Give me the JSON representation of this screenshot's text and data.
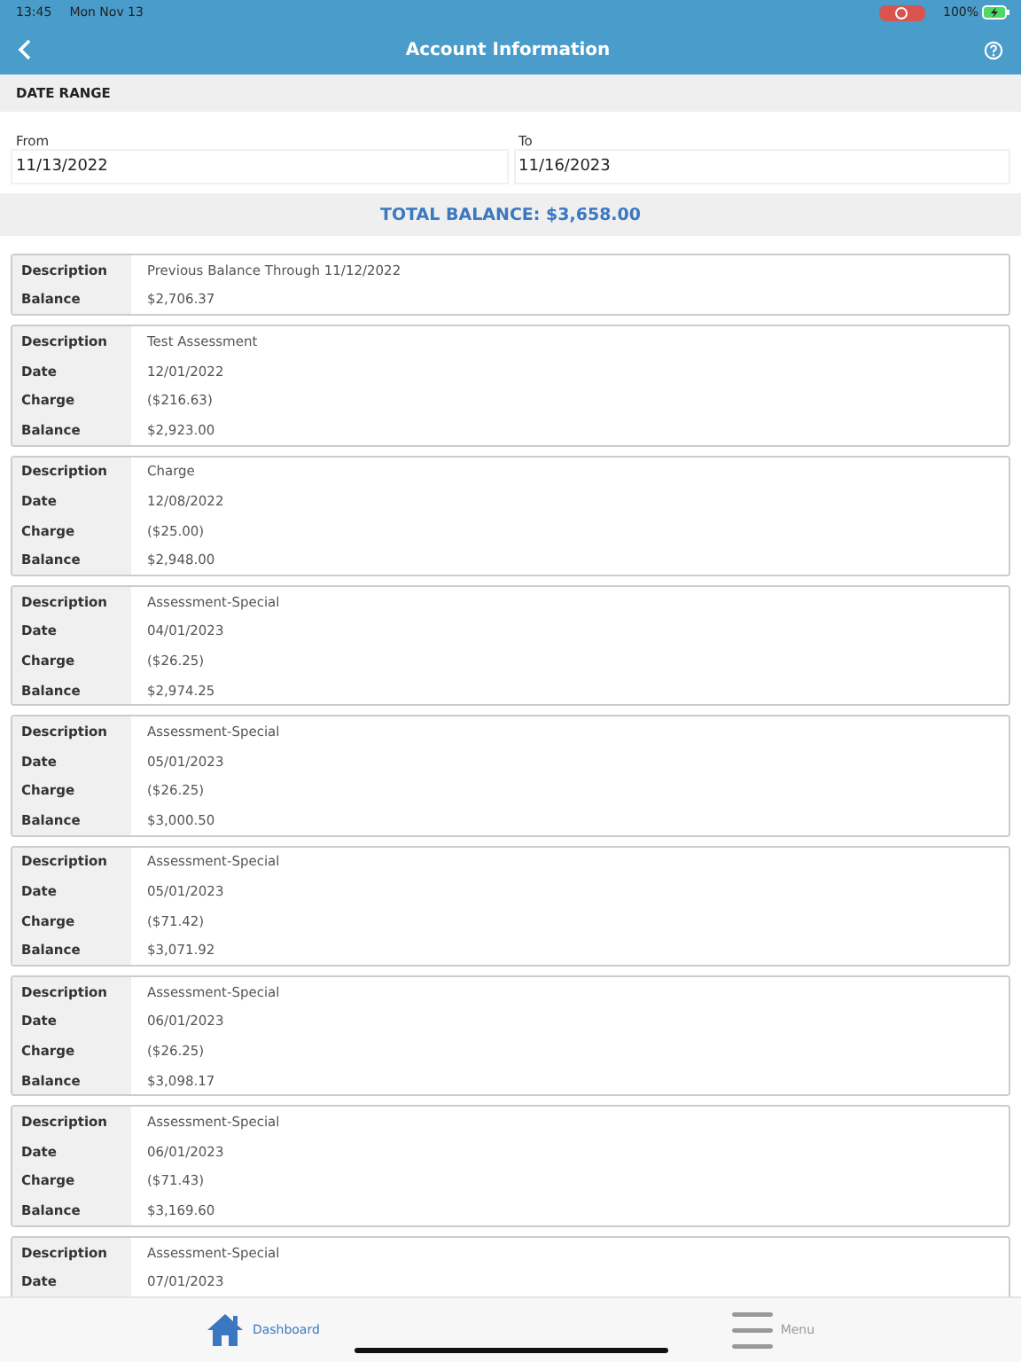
{
  "status_bar": {
    "time": "13:45",
    "date": "Mon Nov 13",
    "battery": "100%"
  },
  "header": {
    "title": "Account Information"
  },
  "date_range": {
    "heading": "DATE RANGE",
    "from_label": "From",
    "from_value": "11/13/2022",
    "to_label": "To",
    "to_value": "11/16/2023"
  },
  "total_balance": "TOTAL BALANCE: $3,658.00",
  "entries": [
    {
      "rows": [
        {
          "label": "Description",
          "value": "Previous Balance Through 11/12/2022"
        },
        {
          "label": "Balance",
          "value": "$2,706.37"
        }
      ]
    },
    {
      "rows": [
        {
          "label": "Description",
          "value": "Test Assessment"
        },
        {
          "label": "Date",
          "value": "12/01/2022"
        },
        {
          "label": "Charge",
          "value": "($216.63)"
        },
        {
          "label": "Balance",
          "value": "$2,923.00"
        }
      ]
    },
    {
      "rows": [
        {
          "label": "Description",
          "value": "Charge"
        },
        {
          "label": "Date",
          "value": "12/08/2022"
        },
        {
          "label": "Charge",
          "value": "($25.00)"
        },
        {
          "label": "Balance",
          "value": "$2,948.00"
        }
      ]
    },
    {
      "rows": [
        {
          "label": "Description",
          "value": "Assessment-Special"
        },
        {
          "label": "Date",
          "value": "04/01/2023"
        },
        {
          "label": "Charge",
          "value": "($26.25)"
        },
        {
          "label": "Balance",
          "value": "$2,974.25"
        }
      ]
    },
    {
      "rows": [
        {
          "label": "Description",
          "value": "Assessment-Special"
        },
        {
          "label": "Date",
          "value": "05/01/2023"
        },
        {
          "label": "Charge",
          "value": "($26.25)"
        },
        {
          "label": "Balance",
          "value": "$3,000.50"
        }
      ]
    },
    {
      "rows": [
        {
          "label": "Description",
          "value": "Assessment-Special"
        },
        {
          "label": "Date",
          "value": "05/01/2023"
        },
        {
          "label": "Charge",
          "value": "($71.42)"
        },
        {
          "label": "Balance",
          "value": "$3,071.92"
        }
      ]
    },
    {
      "rows": [
        {
          "label": "Description",
          "value": "Assessment-Special"
        },
        {
          "label": "Date",
          "value": "06/01/2023"
        },
        {
          "label": "Charge",
          "value": "($26.25)"
        },
        {
          "label": "Balance",
          "value": "$3,098.17"
        }
      ]
    },
    {
      "rows": [
        {
          "label": "Description",
          "value": "Assessment-Special"
        },
        {
          "label": "Date",
          "value": "06/01/2023"
        },
        {
          "label": "Charge",
          "value": "($71.43)"
        },
        {
          "label": "Balance",
          "value": "$3,169.60"
        }
      ]
    },
    {
      "rows": [
        {
          "label": "Description",
          "value": "Assessment-Special"
        },
        {
          "label": "Date",
          "value": "07/01/2023"
        }
      ]
    }
  ],
  "tab_bar": [
    {
      "kind": "home",
      "label": "Dashboard",
      "selected": true
    },
    {
      "kind": "menu",
      "label": "Menu",
      "selected": false
    }
  ]
}
